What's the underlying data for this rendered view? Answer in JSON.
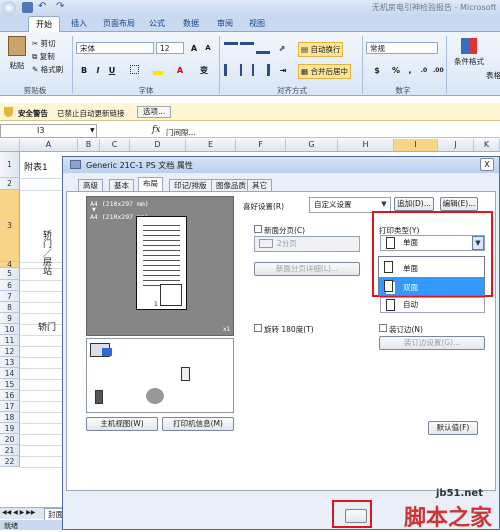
{
  "excel": {
    "title": "无机房电引神检验报告 - Microsoft",
    "tabs": [
      "开始",
      "插入",
      "页面布局",
      "公式",
      "数据",
      "审阅",
      "视图"
    ],
    "clipboard": {
      "paste": "粘贴",
      "cut": "剪切",
      "copy": "复制",
      "format_painter": "格式刷",
      "label": "剪贴板"
    },
    "font": {
      "name": "宋体",
      "size": "12",
      "grow": "A",
      "shrink": "A",
      "bold": "B",
      "italic": "I",
      "underline": "U",
      "wen": "变",
      "label": "字体"
    },
    "alignment": {
      "wrap": "自动换行",
      "merge": "合并后居中",
      "label": "对齐方式"
    },
    "number": {
      "format": "常规",
      "percent": "%",
      "comma": ",",
      "label": "数字"
    },
    "styles": {
      "conditional": "条件格式",
      "table_short": "表格"
    },
    "security": {
      "title": "安全警告",
      "message": "已禁止自动更新链接",
      "options": "选项..."
    },
    "namebox": "I3",
    "formula": "门间隙...",
    "columns": [
      "A",
      "B",
      "C",
      "D",
      "E",
      "F",
      "G",
      "H",
      "I",
      "J",
      "K"
    ],
    "rows": [
      "1",
      "2",
      "3",
      "4",
      "5",
      "6",
      "7",
      "8",
      "9",
      "10",
      "11",
      "12",
      "13",
      "14",
      "15",
      "16",
      "17",
      "18",
      "19",
      "20",
      "21",
      "22"
    ],
    "cells": {
      "a1": "附表1",
      "a3": "轿门／层站",
      "a5": "轿门"
    },
    "sheet_tab": "封面",
    "status": "就绪"
  },
  "dialog": {
    "title": "Generic 21C-1 PS 文档 属性",
    "close": "X",
    "tabs": [
      "高级",
      "基本",
      "布局",
      "印记/排版",
      "图像品质",
      "其它"
    ],
    "active_tab": "布局",
    "preview_text": [
      "A4  (210x297 mm)",
      "▼",
      "A4  (210x297 mm)"
    ],
    "preview_scale": "x1",
    "page_num": "1",
    "printer_view_button": "主机视图(W)",
    "printer_info_button": "打印机信息(M)",
    "favorites_label": "喜好设置(R)",
    "favorites_value": "自定义设置",
    "add_button": "追加(D)...",
    "edit_button": "编辑(E)...",
    "new_sheet_label": "新面分页(C)",
    "pages_value": "2分页",
    "new_sheet_detail_button": "新面分页详细(L)...",
    "rotate_label": "旋转 180度(T)",
    "print_type_label": "打印类型(Y)",
    "print_type_value": "单面",
    "print_type_options": [
      "单面",
      "双面"
    ],
    "binding_value": "自动",
    "binding_margin_label": "装订边(N)",
    "binding_settings_button": "装订边设置(G)...",
    "default_button": "默认值(F)"
  },
  "watermark": {
    "site": "jb51.net",
    "brand": "脚本之家"
  },
  "colors": {
    "highlight": "#3399ff",
    "red": "#e0141e",
    "tab_blue": "#15428b"
  }
}
